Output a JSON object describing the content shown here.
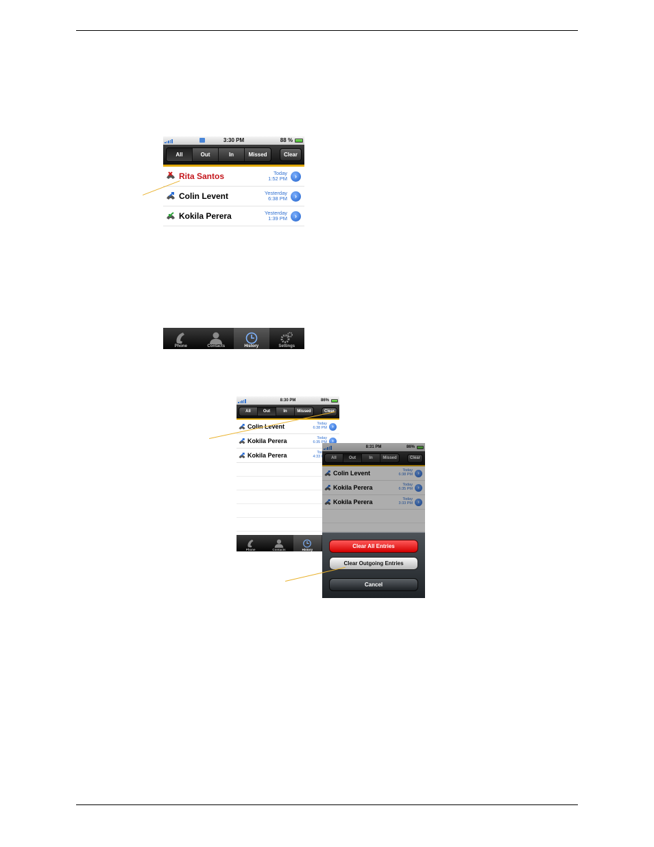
{
  "screens": [
    {
      "status": {
        "time": "3:30 PM",
        "battery": "88 %"
      },
      "tabs": [
        "All",
        "Out",
        "In",
        "Missed"
      ],
      "active_tab": "All",
      "clear_label": "Clear",
      "calls": [
        {
          "name": "Rita Santos",
          "day": "Today",
          "time": "1:52 PM",
          "type": "missed",
          "icon": "missed-call-icon"
        },
        {
          "name": "Colin Levent",
          "day": "Yesterday",
          "time": "6:38 PM",
          "type": "outgoing",
          "icon": "outgoing-call-icon"
        },
        {
          "name": "Kokila Perera",
          "day": "Yesterday",
          "time": "1:39 PM",
          "type": "incoming",
          "icon": "incoming-call-icon"
        }
      ],
      "tabbar": [
        {
          "label": "Phone",
          "icon": "phone-icon"
        },
        {
          "label": "Contacts",
          "icon": "contacts-icon"
        },
        {
          "label": "History",
          "icon": "clock-icon"
        },
        {
          "label": "Settings",
          "icon": "gear-icon"
        }
      ],
      "active_tabbar": "History"
    },
    {
      "status": {
        "time": "8:30 PM",
        "battery": "86%"
      },
      "tabs": [
        "All",
        "Out",
        "In",
        "Missed"
      ],
      "active_tab": "Out",
      "clear_label": "Clear",
      "calls": [
        {
          "name": "Colin Levent",
          "day": "Today",
          "time": "6:38 PM",
          "type": "outgoing",
          "icon": "outgoing-call-icon"
        },
        {
          "name": "Kokila Perera",
          "day": "Today",
          "time": "6:35 PM",
          "type": "outgoing",
          "icon": "outgoing-call-icon"
        },
        {
          "name": "Kokila Perera",
          "day": "Today",
          "time": "4:33 PM",
          "type": "outgoing",
          "icon": "outgoing-call-icon"
        }
      ],
      "tabbar": [
        {
          "label": "Phone",
          "icon": "phone-icon"
        },
        {
          "label": "Contacts",
          "icon": "contacts-icon"
        },
        {
          "label": "History",
          "icon": "clock-icon"
        }
      ],
      "active_tabbar": "History"
    },
    {
      "status": {
        "time": "8:31 PM",
        "battery": "86%"
      },
      "tabs": [
        "All",
        "Out",
        "In",
        "Missed"
      ],
      "active_tab": "Out",
      "clear_label": "Clear",
      "calls": [
        {
          "name": "Colin Levent",
          "day": "Today",
          "time": "6:38 PM",
          "type": "outgoing",
          "icon": "outgoing-call-icon"
        },
        {
          "name": "Kokila Perera",
          "day": "Today",
          "time": "6:35 PM",
          "type": "outgoing",
          "icon": "outgoing-call-icon"
        },
        {
          "name": "Kokila Perera",
          "day": "Today",
          "time": "3:33 PM",
          "type": "outgoing",
          "icon": "outgoing-call-icon"
        }
      ],
      "action_sheet": {
        "clear_all": "Clear All Entries",
        "clear_outgoing": "Clear Outgoing Entries",
        "cancel": "Cancel"
      }
    }
  ],
  "colors": {
    "accent_gold": "#e1a800",
    "missed_red": "#c4161c",
    "link_blue": "#2f6fd0"
  }
}
